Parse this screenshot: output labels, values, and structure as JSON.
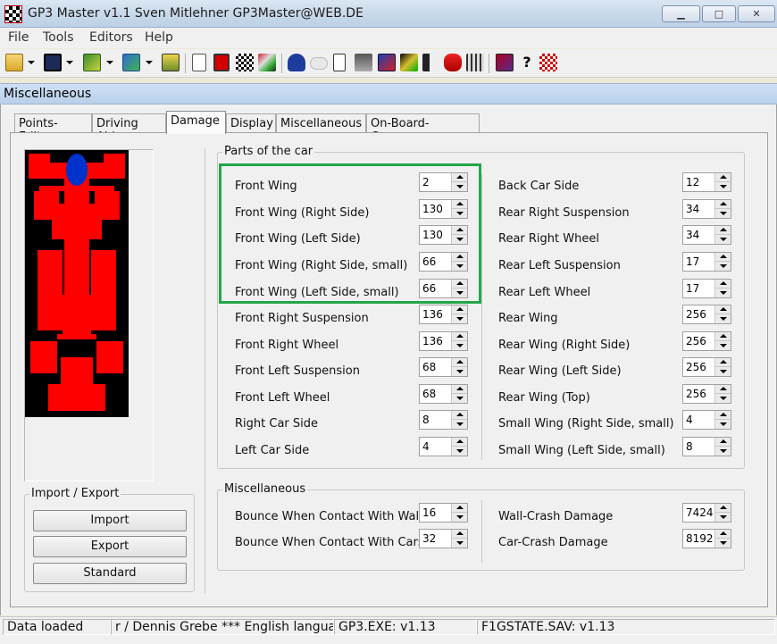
{
  "window": {
    "title": "GP3 Master v1.1 Sven Mitlehner GP3Master@WEB.DE",
    "controls": {
      "minimize": "▁",
      "maximize": "□",
      "close": "✕"
    }
  },
  "menu": [
    "File",
    "Tools",
    "Editors",
    "Help"
  ],
  "toolbar_icons": [
    "open-folder-icon",
    "save-icon",
    "gp3-icon",
    "gp3-alt-icon",
    "hardware-icon",
    "new-document-icon",
    "stop-icon",
    "checkered-flag-icon",
    "car-set-icon",
    "helmet-icon",
    "cloud-icon",
    "notes-icon",
    "pitcrew-icon",
    "picture-icon",
    "flag-swap-icon",
    "speaker-icon",
    "driver-icon",
    "race-start-icon",
    "book-icon",
    "help-icon",
    "checker-icon"
  ],
  "child_window": {
    "title": "Miscellaneous"
  },
  "tabs": [
    "Points-Editor",
    "Driving Aids",
    "Damage",
    "Display",
    "Miscellaneous",
    "On-Board-Cameras"
  ],
  "active_tab": "Damage",
  "parts_group": {
    "label": "Parts of the car",
    "left": [
      {
        "label": "Front Wing",
        "value": "2"
      },
      {
        "label": "Front Wing (Right Side)",
        "value": "130"
      },
      {
        "label": "Front Wing (Left Side)",
        "value": "130"
      },
      {
        "label": "Front Wing (Right Side, small)",
        "value": "66"
      },
      {
        "label": "Front Wing (Left Side, small)",
        "value": "66"
      },
      {
        "label": "Front Right Suspension",
        "value": "136"
      },
      {
        "label": "Front Right Wheel",
        "value": "136"
      },
      {
        "label": "Front Left Suspension",
        "value": "68"
      },
      {
        "label": "Front Left Wheel",
        "value": "68"
      },
      {
        "label": "Right Car Side",
        "value": "8"
      },
      {
        "label": "Left Car Side",
        "value": "4"
      }
    ],
    "right": [
      {
        "label": "Back Car Side",
        "value": "12"
      },
      {
        "label": "Rear Right Suspension",
        "value": "34"
      },
      {
        "label": "Rear Right Wheel",
        "value": "34"
      },
      {
        "label": "Rear Left Suspension",
        "value": "17"
      },
      {
        "label": "Rear Left Wheel",
        "value": "17"
      },
      {
        "label": "Rear Wing",
        "value": "256"
      },
      {
        "label": "Rear Wing (Right Side)",
        "value": "256"
      },
      {
        "label": "Rear Wing (Left Side)",
        "value": "256"
      },
      {
        "label": "Rear Wing (Top)",
        "value": "256"
      },
      {
        "label": "Small Wing (Right Side, small)",
        "value": "4"
      },
      {
        "label": "Small Wing (Left Side, small)",
        "value": "8"
      }
    ]
  },
  "misc_group": {
    "label": "Miscellaneous",
    "left": [
      {
        "label": "Bounce When Contact With Walls",
        "value": "16"
      },
      {
        "label": "Bounce When Contact With Cars",
        "value": "32"
      }
    ],
    "right": [
      {
        "label": "Wall-Crash Damage",
        "value": "7424"
      },
      {
        "label": "Car-Crash Damage",
        "value": "8192"
      }
    ]
  },
  "import_export": {
    "label": "Import / Export",
    "buttons": [
      "Import",
      "Export",
      "Standard"
    ]
  },
  "colors": {
    "car_body": "#ff0000",
    "car_helmet": "#0033cc",
    "highlight_box": "#23a64a"
  },
  "status": [
    "Data loaded",
    "r / Dennis Grebe *** English language",
    "GP3.EXE: v1.13",
    "F1GSTATE.SAV: v1.13"
  ]
}
